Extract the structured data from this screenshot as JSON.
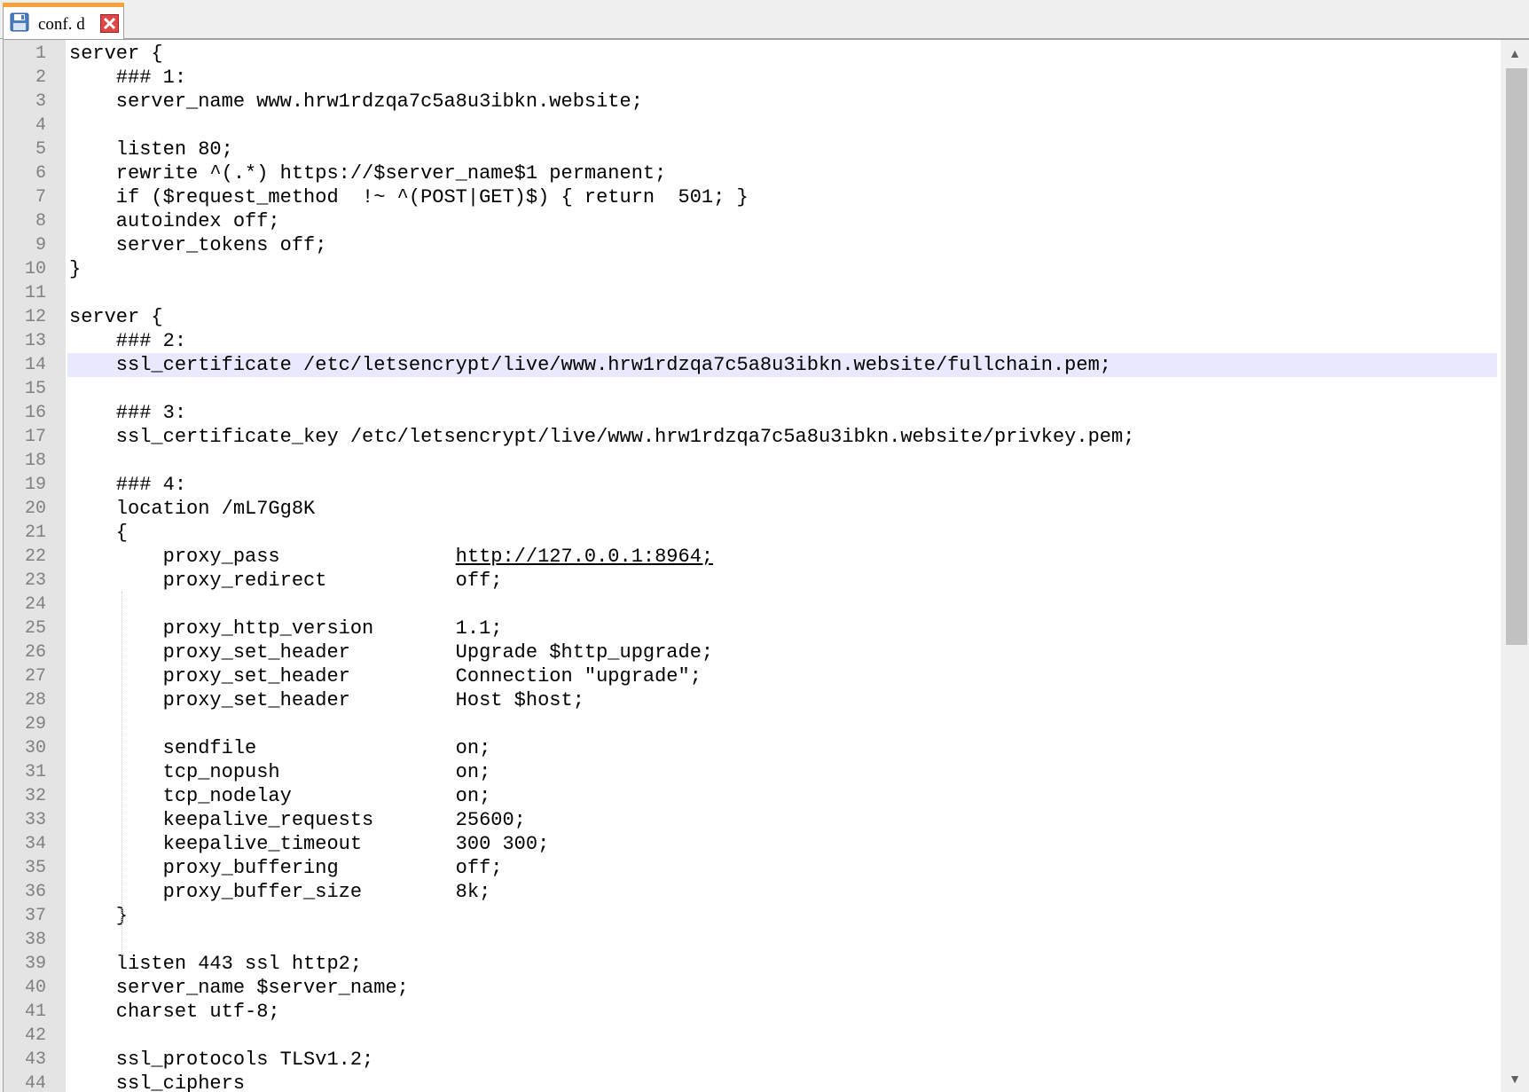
{
  "tab": {
    "title": "conf. d",
    "icon": "save-icon",
    "close_icon": "close-icon",
    "accent_color": "#f5a23a"
  },
  "editor": {
    "current_line": 14,
    "lines": [
      {
        "n": "1",
        "text": "server {"
      },
      {
        "n": "2",
        "text": "    ### 1:"
      },
      {
        "n": "3",
        "text": "    server_name www.hrw1rdzqa7c5a8u3ibkn.website;"
      },
      {
        "n": "4",
        "text": ""
      },
      {
        "n": "5",
        "text": "    listen 80;"
      },
      {
        "n": "6",
        "text": "    rewrite ^(.*) https://$server_name$1 permanent;"
      },
      {
        "n": "7",
        "text": "    if ($request_method  !~ ^(POST|GET)$) { return  501; }"
      },
      {
        "n": "8",
        "text": "    autoindex off;"
      },
      {
        "n": "9",
        "text": "    server_tokens off;"
      },
      {
        "n": "10",
        "text": "}"
      },
      {
        "n": "11",
        "text": ""
      },
      {
        "n": "12",
        "text": "server {"
      },
      {
        "n": "13",
        "text": "    ### 2:"
      },
      {
        "n": "14",
        "text": "    ssl_certificate /etc/letsencrypt/live/www.hrw1rdzqa7c5a8u3ibkn.website/fullchain.pem;"
      },
      {
        "n": "15",
        "text": ""
      },
      {
        "n": "16",
        "text": "    ### 3:"
      },
      {
        "n": "17",
        "text": "    ssl_certificate_key /etc/letsencrypt/live/www.hrw1rdzqa7c5a8u3ibkn.website/privkey.pem;"
      },
      {
        "n": "18",
        "text": ""
      },
      {
        "n": "19",
        "text": "    ### 4:"
      },
      {
        "n": "20",
        "text": "    location /mL7Gg8K"
      },
      {
        "n": "21",
        "text": "    {"
      },
      {
        "n": "22",
        "pre": "        proxy_pass               ",
        "url": "http://127.0.0.1:8964;"
      },
      {
        "n": "23",
        "text": "        proxy_redirect           off;"
      },
      {
        "n": "24",
        "text": ""
      },
      {
        "n": "25",
        "text": "        proxy_http_version       1.1;"
      },
      {
        "n": "26",
        "text": "        proxy_set_header         Upgrade $http_upgrade;"
      },
      {
        "n": "27",
        "text": "        proxy_set_header         Connection \"upgrade\";"
      },
      {
        "n": "28",
        "text": "        proxy_set_header         Host $host;"
      },
      {
        "n": "29",
        "text": ""
      },
      {
        "n": "30",
        "text": "        sendfile                 on;"
      },
      {
        "n": "31",
        "text": "        tcp_nopush               on;"
      },
      {
        "n": "32",
        "text": "        tcp_nodelay              on;"
      },
      {
        "n": "33",
        "text": "        keepalive_requests       25600;"
      },
      {
        "n": "34",
        "text": "        keepalive_timeout        300 300;"
      },
      {
        "n": "35",
        "text": "        proxy_buffering          off;"
      },
      {
        "n": "36",
        "text": "        proxy_buffer_size        8k;"
      },
      {
        "n": "37",
        "text": "    }"
      },
      {
        "n": "38",
        "text": ""
      },
      {
        "n": "39",
        "text": "    listen 443 ssl http2;"
      },
      {
        "n": "40",
        "text": "    server_name $server_name;"
      },
      {
        "n": "41",
        "text": "    charset utf-8;"
      },
      {
        "n": "42",
        "text": ""
      },
      {
        "n": "43",
        "text": "    ssl_protocols TLSv1.2;"
      },
      {
        "n": "44",
        "text": "    ssl_ciphers"
      }
    ]
  },
  "scrollbar": {
    "up_icon": "arrow-up-icon",
    "down_icon": "arrow-down-icon"
  }
}
